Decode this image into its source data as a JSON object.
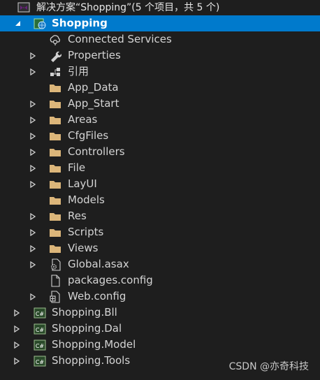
{
  "solution": {
    "label": "解决方案“Shopping”(5 个项目，共 5 个)"
  },
  "project": {
    "label": "Shopping"
  },
  "items": [
    {
      "label": "Connected Services"
    },
    {
      "label": "Properties"
    },
    {
      "label": "引用"
    },
    {
      "label": "App_Data"
    },
    {
      "label": "App_Start"
    },
    {
      "label": "Areas"
    },
    {
      "label": "CfgFiles"
    },
    {
      "label": "Controllers"
    },
    {
      "label": "File"
    },
    {
      "label": "LayUI"
    },
    {
      "label": "Models"
    },
    {
      "label": "Res"
    },
    {
      "label": "Scripts"
    },
    {
      "label": "Views"
    },
    {
      "label": "Global.asax"
    },
    {
      "label": "packages.config"
    },
    {
      "label": "Web.config"
    }
  ],
  "projects": [
    {
      "label": "Shopping.Bll"
    },
    {
      "label": "Shopping.Dal"
    },
    {
      "label": "Shopping.Model"
    },
    {
      "label": "Shopping.Tools"
    }
  ],
  "watermark": "CSDN @亦奇科技",
  "colors": {
    "background": "#1e1e1e",
    "selection": "#007acc",
    "folder": "#dcb67a",
    "csproj_green": "#9cbd8d"
  }
}
